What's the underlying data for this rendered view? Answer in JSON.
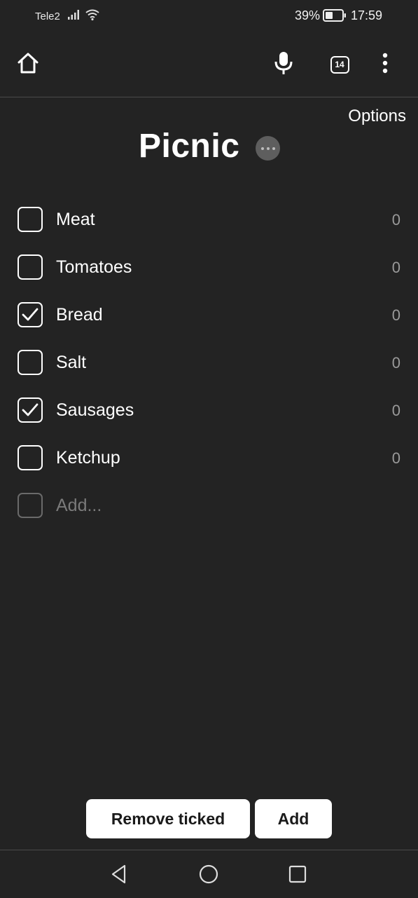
{
  "status_bar": {
    "carrier": "Tele2",
    "battery_percent": "39%",
    "time": "17:59"
  },
  "toolbar": {
    "tabs_count": "14",
    "icons": [
      "home-icon",
      "microphone-icon",
      "tabs-icon",
      "more-vertical-icon"
    ]
  },
  "header": {
    "options_label": "Options",
    "title": "Picnic"
  },
  "list": {
    "items": [
      {
        "label": "Meat",
        "quantity": "0",
        "checked": false
      },
      {
        "label": "Tomatoes",
        "quantity": "0",
        "checked": false
      },
      {
        "label": "Bread",
        "quantity": "0",
        "checked": true
      },
      {
        "label": "Salt",
        "quantity": "0",
        "checked": false
      },
      {
        "label": "Sausages",
        "quantity": "0",
        "checked": true
      },
      {
        "label": "Ketchup",
        "quantity": "0",
        "checked": false
      }
    ],
    "add_placeholder": "Add..."
  },
  "actions": {
    "remove_ticked_label": "Remove ticked",
    "add_label": "Add"
  },
  "colors": {
    "background": "#232323",
    "text": "#ffffff",
    "muted": "#9a9a9a",
    "button_bg": "#ffffff"
  }
}
